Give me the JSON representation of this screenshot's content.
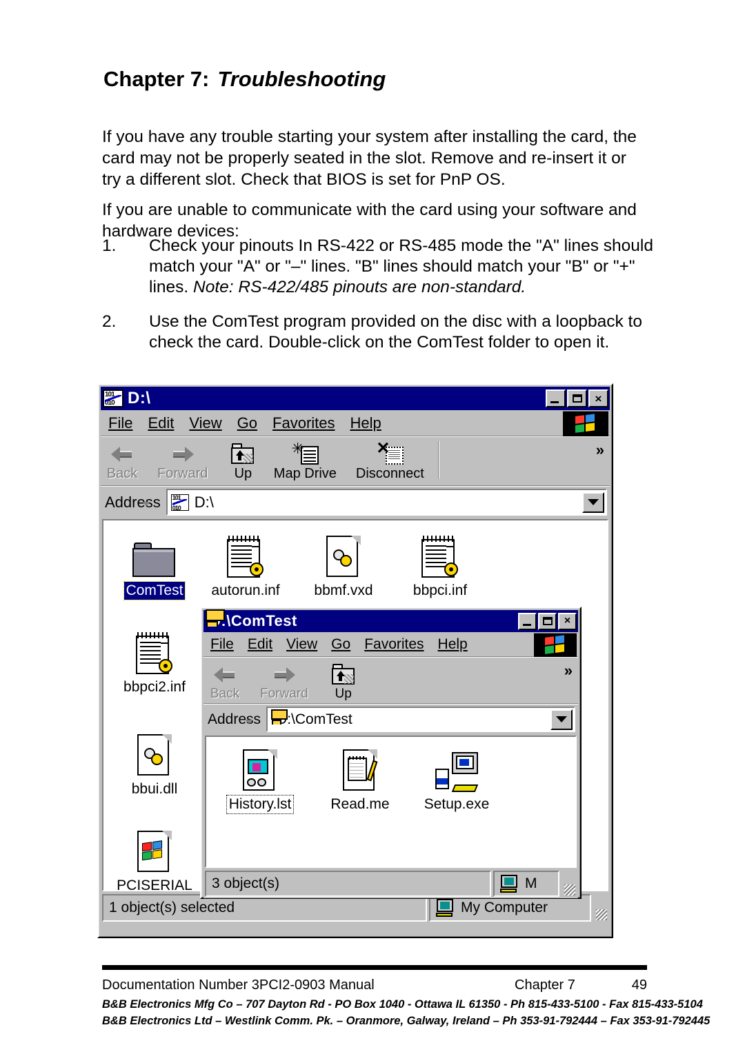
{
  "document": {
    "heading_prefix": "Chapter 7:",
    "heading_title": "Troubleshooting",
    "paragraph_1": "If you have any trouble starting your system after installing the card, the card may not be properly seated in the slot. Remove and re-insert it or try a different slot. Check that BIOS is set for PnP OS.",
    "paragraph_2": "If you are unable to communicate with the card using your software and hardware devices:",
    "list": [
      {
        "number": "1.",
        "text": "Check your pinouts  In RS-422 or RS-485 mode the \"A\" lines should match your \"A\" or \"–\" lines.  \"B\" lines should match your \"B\" or \"+\" lines.  ",
        "note": "Note: RS-422/485 pinouts are non-standard."
      },
      {
        "number": "2.",
        "text": "Use the ComTest program provided on the disc with a loopback to check the card. Double-click on the ComTest folder to open it.",
        "note": ""
      }
    ]
  },
  "outer_window": {
    "title": "D:\\",
    "title_icon": "data-disc-drive-icon",
    "min_label": "_",
    "max_label": "□",
    "close_label": "×",
    "menu": [
      "File",
      "Edit",
      "View",
      "Go",
      "Favorites",
      "Help"
    ],
    "toolbar": {
      "buttons": [
        {
          "label": "Back",
          "icon": "back-arrow-icon",
          "disabled": true,
          "dropdown": true
        },
        {
          "label": "Forward",
          "icon": "forward-arrow-icon",
          "disabled": true,
          "dropdown": true
        },
        {
          "label": "Up",
          "icon": "up-folder-icon",
          "disabled": false,
          "dropdown": false
        },
        {
          "label": "Map Drive",
          "icon": "map-drive-icon",
          "disabled": false,
          "dropdown": false
        },
        {
          "label": "Disconnect",
          "icon": "disconnect-icon",
          "disabled": false,
          "dropdown": false
        }
      ],
      "overflow_chevron": "»"
    },
    "address": {
      "label": "Address",
      "value": "D:\\",
      "icon": "data-disc-drive-icon"
    },
    "items": [
      {
        "name": "ComTest",
        "icon": "folder-icon",
        "state": "selected"
      },
      {
        "name": "autorun.inf",
        "icon": "inf-file-icon",
        "state": "normal"
      },
      {
        "name": "bbmf.vxd",
        "icon": "vxd-file-icon",
        "state": "normal"
      },
      {
        "name": "bbpci.inf",
        "icon": "inf-file-icon",
        "state": "normal"
      },
      {
        "name": "bbpci2.inf",
        "icon": "inf-file-icon",
        "state": "normal"
      },
      {
        "name": "bbui.dll",
        "icon": "dll-file-icon",
        "state": "normal"
      },
      {
        "name": "PCISERIAL",
        "icon": "windows-file-icon",
        "state": "normal"
      }
    ],
    "status": {
      "left": "1 object(s) selected",
      "right": "My Computer",
      "right_icon": "my-computer-icon"
    }
  },
  "inner_window": {
    "title": "D:\\ComTest",
    "title_icon": "open-folder-icon",
    "min_label": "_",
    "max_label": "□",
    "close_label": "×",
    "menu": [
      "File",
      "Edit",
      "View",
      "Go",
      "Favorites",
      "Help"
    ],
    "toolbar": {
      "buttons": [
        {
          "label": "Back",
          "icon": "back-arrow-icon",
          "disabled": true,
          "dropdown": true
        },
        {
          "label": "Forward",
          "icon": "forward-arrow-icon",
          "disabled": true,
          "dropdown": true
        },
        {
          "label": "Up",
          "icon": "up-folder-icon",
          "disabled": false,
          "dropdown": false
        }
      ],
      "overflow_chevron": "»"
    },
    "address": {
      "label": "Address",
      "value": "D:\\ComTest",
      "icon": "open-folder-icon"
    },
    "items": [
      {
        "name": "History.lst",
        "icon": "history-file-icon",
        "state": "focused"
      },
      {
        "name": "Read.me",
        "icon": "readme-file-icon",
        "state": "normal"
      },
      {
        "name": "Setup.exe",
        "icon": "setup-exe-icon",
        "state": "normal"
      }
    ],
    "status": {
      "left": "3 object(s)",
      "right": "M",
      "right_icon": "my-computer-icon"
    }
  },
  "footer": {
    "doc_number": "Documentation Number 3PCI2-0903 Manual",
    "chapter": "Chapter 7",
    "page": "49",
    "address_line_1": "B&B Electronics Mfg Co – 707 Dayton Rd - PO Box 1040 - Ottawa IL 61350 - Ph 815-433-5100 - Fax 815-433-5104",
    "address_line_2": "B&B Electronics Ltd – Westlink Comm. Pk. – Oranmore, Galway, Ireland – Ph 353-91-792444 – Fax 353-91-792445"
  },
  "colors": {
    "titlebar": "#000080",
    "window_face": "#c0c0c0",
    "selection": "#000080",
    "page_background": "#ffffff"
  }
}
